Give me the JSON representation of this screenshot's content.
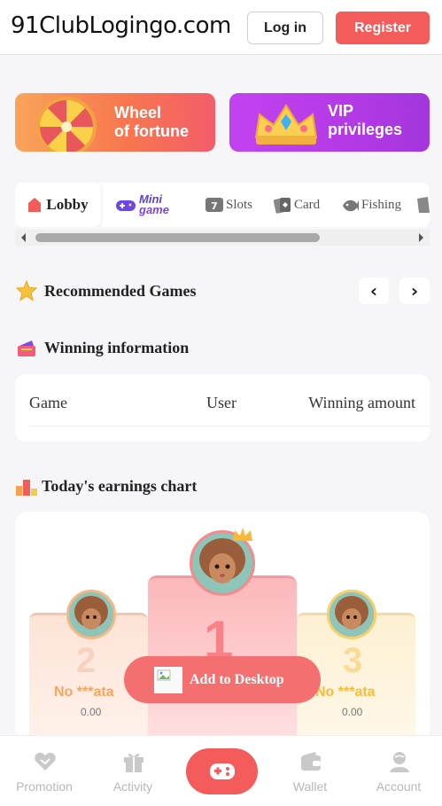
{
  "header": {
    "site_title": "91ClubLogingo.com",
    "login_label": "Log in",
    "register_label": "Register"
  },
  "banners": {
    "wheel": {
      "line1": "Wheel",
      "line2": "of fortune"
    },
    "vip": {
      "line1": "VIP",
      "line2": "privileges"
    }
  },
  "game_tabs": {
    "lobby": "Lobby",
    "minigame_line1": "Mini",
    "minigame_line2": "game",
    "slots": "Slots",
    "card": "Card",
    "fishing": "Fishing"
  },
  "recommended": {
    "title": "Recommended Games",
    "prev": "‹",
    "next": "›"
  },
  "winning": {
    "title": "Winning information",
    "columns": [
      "Game",
      "User",
      "Winning amount"
    ]
  },
  "earnings": {
    "title": "Today's earnings chart",
    "ranks": [
      {
        "rank": "1",
        "name": "",
        "amount": ""
      },
      {
        "rank": "2",
        "name": "No ***ata",
        "amount": "0.00"
      },
      {
        "rank": "3",
        "name": "No ***ata",
        "amount": "0.00"
      }
    ]
  },
  "add_to_desktop": {
    "label": "Add to Desktop"
  },
  "bottom_nav": {
    "items": [
      "Promotion",
      "Activity",
      "",
      "Wallet",
      "Account"
    ]
  },
  "colors": {
    "accent": "#f45b5b",
    "rank2": "#f7a45f",
    "rank3": "#f6bc3c",
    "nav_text": "#b7b7b7"
  }
}
